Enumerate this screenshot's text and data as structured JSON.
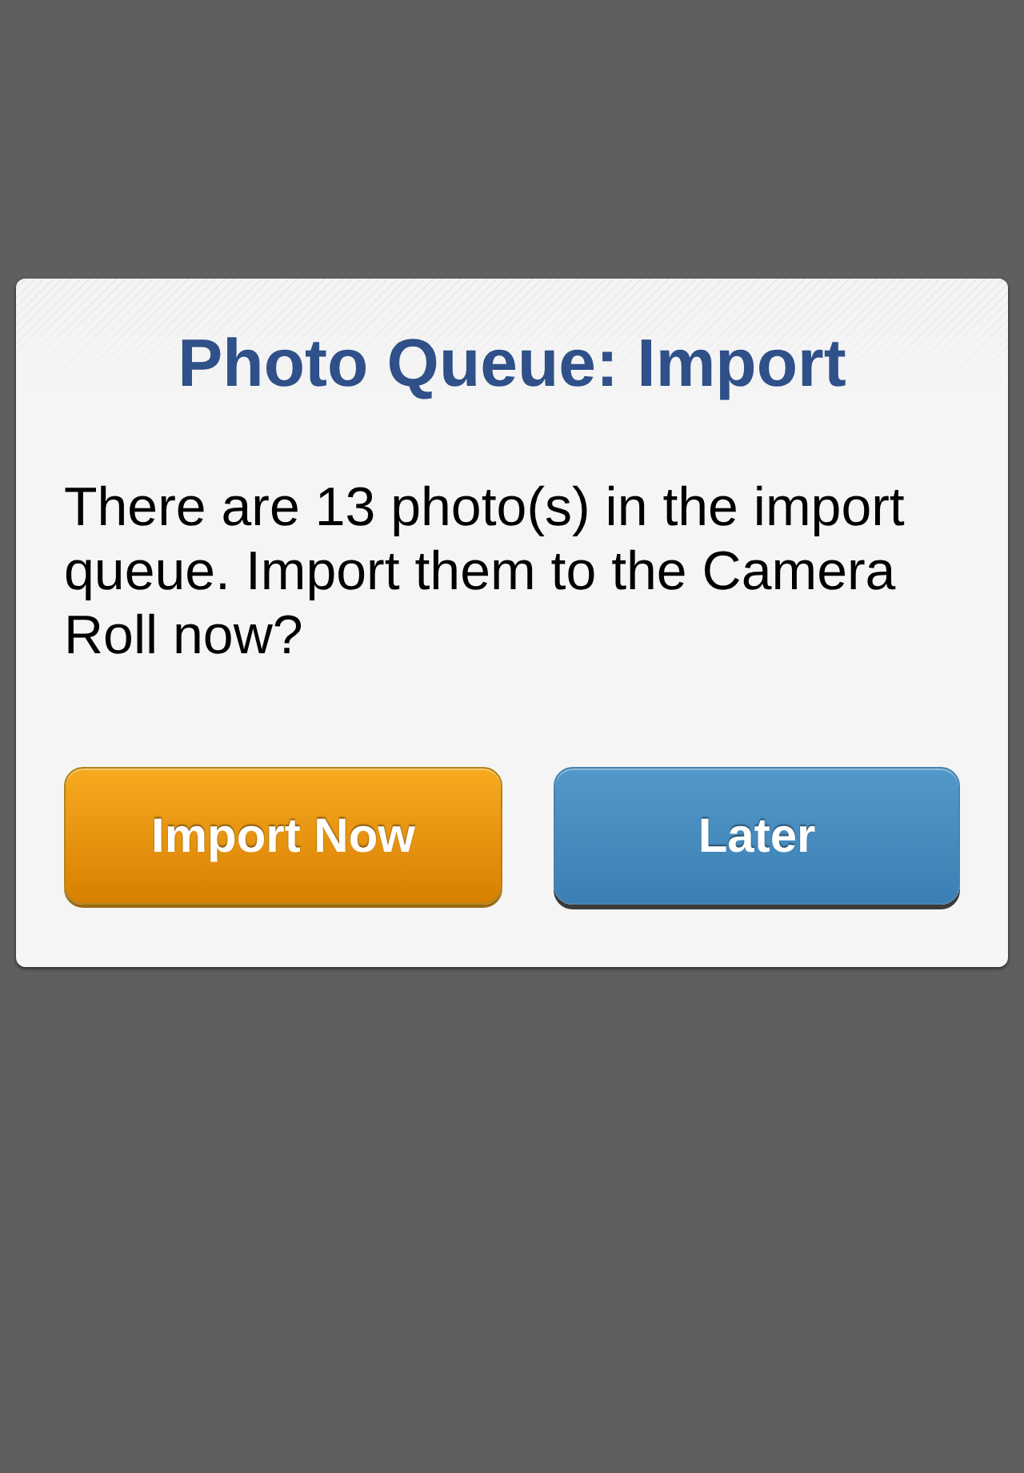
{
  "dialog": {
    "title": "Photo Queue: Import",
    "message": "There are 13 photo(s) in the import queue. Import them to the Camera Roll now?",
    "buttons": [
      {
        "label": "Import Now",
        "kind": "primary"
      },
      {
        "label": "Later",
        "kind": "secondary"
      }
    ]
  }
}
